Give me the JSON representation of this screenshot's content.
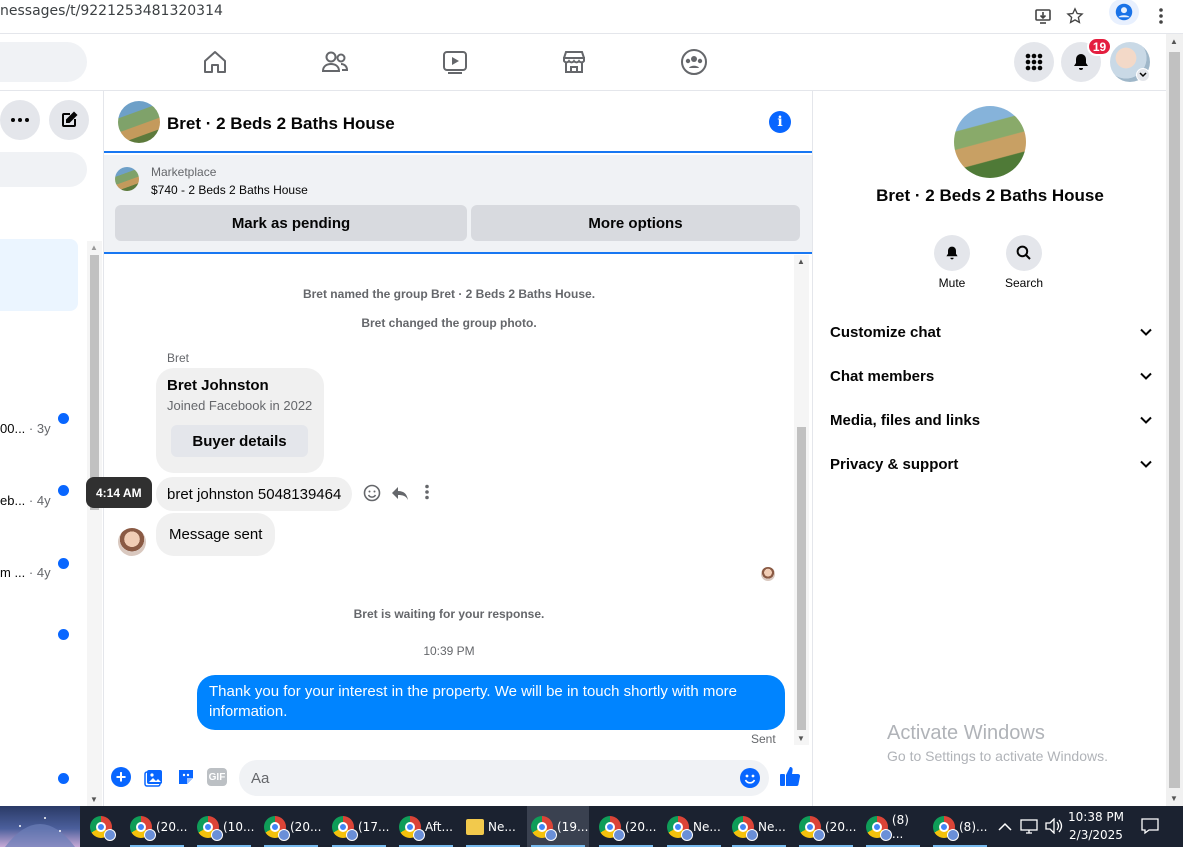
{
  "browser": {
    "url": "nessages/t/9221253481320314",
    "icons": [
      "install-icon",
      "star-icon",
      "profile-icon",
      "menu-icon"
    ]
  },
  "header": {
    "nav_icons": [
      "home-icon",
      "friends-icon",
      "watch-icon",
      "marketplace-icon",
      "groups-icon"
    ],
    "notification_count": "19"
  },
  "left": {
    "rows": [
      {
        "snippet": "00...",
        "time": "· 3y"
      },
      {
        "snippet": "eb...",
        "time": "· 4y"
      },
      {
        "snippet": "m ...",
        "time": "· 4y"
      }
    ]
  },
  "chat": {
    "title": "Bret · 2 Beds 2 Baths House",
    "marketplace_label": "Marketplace",
    "listing": "$740 - 2 Beds 2 Baths House",
    "mark_pending": "Mark as pending",
    "more_options": "More options",
    "system_messages": {
      "named": "Bret named the group Bret · 2 Beds 2 Baths House.",
      "photo": "Bret changed the group photo.",
      "waiting": "Bret is waiting for your response.",
      "time": "10:39 PM"
    },
    "sender_name": "Bret",
    "card": {
      "name": "Bret Johnston",
      "joined": "Joined Facebook in 2022",
      "button": "Buyer details"
    },
    "tooltip_time": "4:14 AM",
    "msg1": "bret johnston 5048139464",
    "msg2": "Message sent",
    "outgoing": "Thank you for your interest in the property. We will be in touch shortly with more information.",
    "status": "Sent",
    "composer_placeholder": "Aa",
    "gif_label": "GIF"
  },
  "right": {
    "title": "Bret · 2 Beds 2 Baths House",
    "mute": "Mute",
    "search": "Search",
    "sections": [
      "Customize chat",
      "Chat members",
      "Media, files and links",
      "Privacy & support"
    ],
    "watermark_title": "Activate Windows",
    "watermark_sub": "Go to Settings to activate Windows."
  },
  "taskbar": {
    "items": [
      {
        "label": "",
        "icon": "chrome-icon"
      },
      {
        "label": "(20...",
        "icon": "chrome-icon"
      },
      {
        "label": "(10...",
        "icon": "chrome-icon"
      },
      {
        "label": "(20...",
        "icon": "chrome-icon"
      },
      {
        "label": "(17...",
        "icon": "chrome-icon"
      },
      {
        "label": "Aft...",
        "icon": "chrome-icon"
      },
      {
        "label": "Ne...",
        "icon": "folder-icon"
      },
      {
        "label": "(19...",
        "icon": "chrome-icon"
      },
      {
        "label": "(20...",
        "icon": "chrome-icon"
      },
      {
        "label": "Ne...",
        "icon": "chrome-icon"
      },
      {
        "label": "Ne...",
        "icon": "chrome-icon"
      },
      {
        "label": "(20...",
        "icon": "chrome-icon"
      },
      {
        "label": "(8) ...",
        "icon": "chrome-icon"
      },
      {
        "label": "(8)...",
        "icon": "chrome-icon"
      }
    ],
    "time": "10:38 PM",
    "date": "2/3/2025"
  },
  "colors": {
    "accent": "#0866ff",
    "outgoing_bubble": "#0084ff",
    "badge": "#e41e3f"
  }
}
